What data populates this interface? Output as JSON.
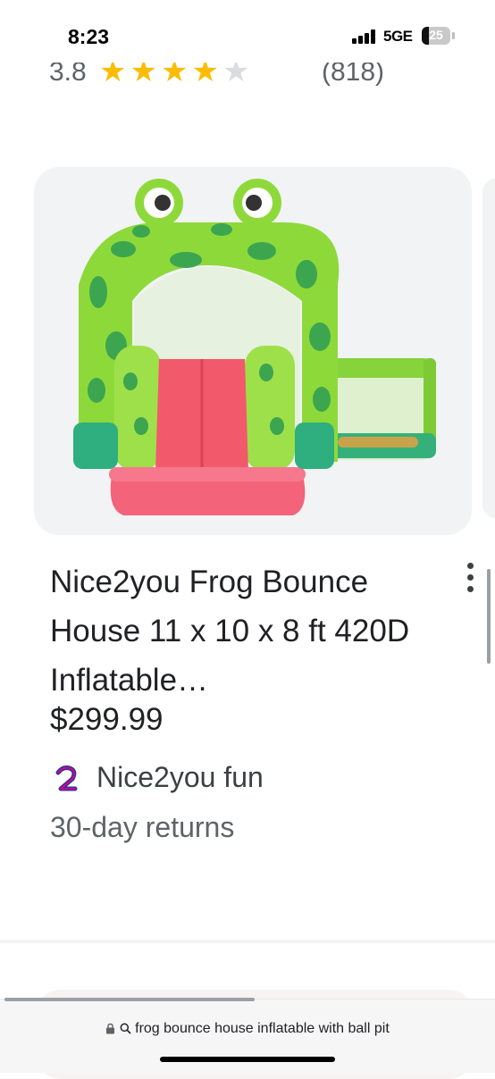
{
  "status_bar": {
    "time": "8:23",
    "network": "5GE",
    "battery": "25"
  },
  "rating": {
    "value": "3.8",
    "stars_filled": 4,
    "stars_total": 5,
    "count": "(818)"
  },
  "product": {
    "image_alt": "Frog bounce house",
    "title": "Nice2you Frog Bounce House 11 x 10 x 8 ft 420D Inflatable…",
    "price": "$299.99",
    "seller": "Nice2you fun",
    "returns": "30-day returns"
  },
  "address_bar": {
    "text": "frog bounce house inflatable with ball pit"
  },
  "colors": {
    "star": "#fbbc04",
    "frog_green": "#7ed321",
    "slide_red": "#f25a6b"
  }
}
